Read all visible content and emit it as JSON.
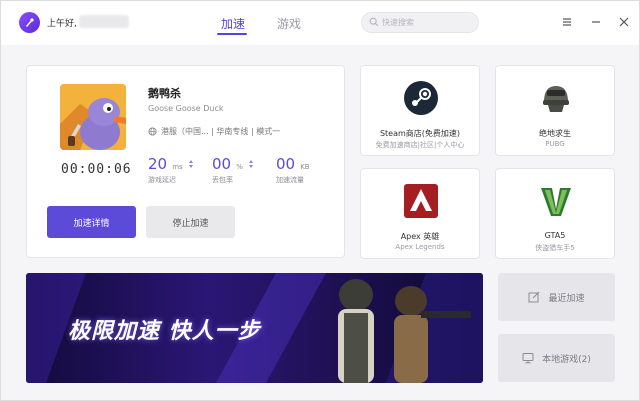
{
  "header": {
    "greeting": "上午好,",
    "tabs": [
      {
        "label": "加速",
        "active": true
      },
      {
        "label": "游戏",
        "active": false
      }
    ],
    "search": {
      "placeholder": "快速搜索"
    },
    "accent_color": "#4f46e5"
  },
  "current_game": {
    "title": "鹅鸭杀",
    "subtitle": "Goose Goose Duck",
    "server": "港服（中国... | 华南专线 | 模式一",
    "timer": "00:00:06",
    "stats": [
      {
        "value": "20",
        "unit": "ms",
        "label": "游戏延迟"
      },
      {
        "value": "00",
        "unit": "%",
        "label": "丢包率"
      },
      {
        "value": "00",
        "unit": "KB",
        "label": "加速流量"
      }
    ],
    "details_button": "加速详情",
    "stop_button": "停止加速"
  },
  "games": [
    {
      "name": "Steam商店(免费加速)",
      "sub": "免费加速商店|社区|个人中心",
      "icon": "steam-icon"
    },
    {
      "name": "绝地求生",
      "sub": "PUBG",
      "icon": "pubg-helmet-icon"
    },
    {
      "name": "Apex 英雄",
      "sub": "Apex Legends",
      "icon": "apex-icon"
    },
    {
      "name": "GTA5",
      "sub": "侠盗猎车手5",
      "icon": "gta5-icon"
    }
  ],
  "banner": {
    "text": "极限加速 快人一步"
  },
  "side_buttons": [
    {
      "label": "最近加速",
      "icon": "edit-icon"
    },
    {
      "label": "本地游戏(2)",
      "icon": "monitor-icon"
    }
  ]
}
